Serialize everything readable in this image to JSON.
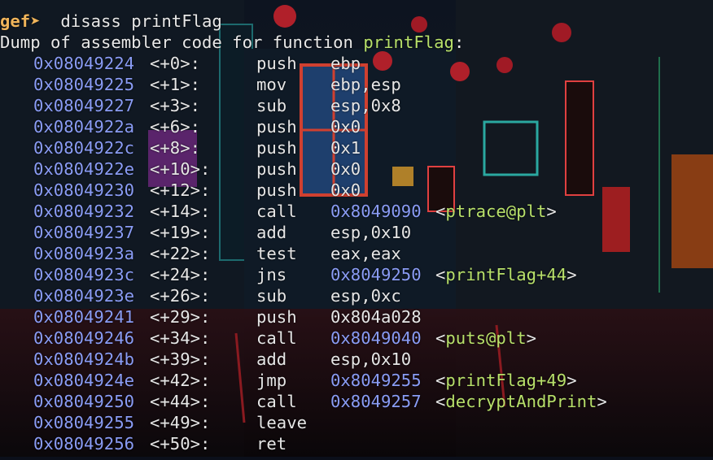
{
  "prompt": {
    "symbol": "gef➤",
    "command": "  disass printFlag"
  },
  "header": {
    "prefix": "Dump of assembler code for function ",
    "function": "printFlag",
    "suffix": ":"
  },
  "instructions": [
    {
      "addr": "0x08049224",
      "off": "<+0>:",
      "mnem": "push",
      "oper": "ebp",
      "target": "",
      "sym": ""
    },
    {
      "addr": "0x08049225",
      "off": "<+1>:",
      "mnem": "mov",
      "oper": "ebp,esp",
      "target": "",
      "sym": ""
    },
    {
      "addr": "0x08049227",
      "off": "<+3>:",
      "mnem": "sub",
      "oper": "esp,0x8",
      "target": "",
      "sym": ""
    },
    {
      "addr": "0x0804922a",
      "off": "<+6>:",
      "mnem": "push",
      "oper": "0x0",
      "target": "",
      "sym": ""
    },
    {
      "addr": "0x0804922c",
      "off": "<+8>:",
      "mnem": "push",
      "oper": "0x1",
      "target": "",
      "sym": ""
    },
    {
      "addr": "0x0804922e",
      "off": "<+10>:",
      "mnem": "push",
      "oper": "0x0",
      "target": "",
      "sym": ""
    },
    {
      "addr": "0x08049230",
      "off": "<+12>:",
      "mnem": "push",
      "oper": "0x0",
      "target": "",
      "sym": ""
    },
    {
      "addr": "0x08049232",
      "off": "<+14>:",
      "mnem": "call",
      "oper": "",
      "target": "0x8049090",
      "sym": "ptrace@plt"
    },
    {
      "addr": "0x08049237",
      "off": "<+19>:",
      "mnem": "add",
      "oper": "esp,0x10",
      "target": "",
      "sym": ""
    },
    {
      "addr": "0x0804923a",
      "off": "<+22>:",
      "mnem": "test",
      "oper": "eax,eax",
      "target": "",
      "sym": ""
    },
    {
      "addr": "0x0804923c",
      "off": "<+24>:",
      "mnem": "jns",
      "oper": "",
      "target": "0x8049250",
      "sym": "printFlag+44"
    },
    {
      "addr": "0x0804923e",
      "off": "<+26>:",
      "mnem": "sub",
      "oper": "esp,0xc",
      "target": "",
      "sym": ""
    },
    {
      "addr": "0x08049241",
      "off": "<+29>:",
      "mnem": "push",
      "oper": "0x804a028",
      "target": "",
      "sym": ""
    },
    {
      "addr": "0x08049246",
      "off": "<+34>:",
      "mnem": "call",
      "oper": "",
      "target": "0x8049040",
      "sym": "puts@plt"
    },
    {
      "addr": "0x0804924b",
      "off": "<+39>:",
      "mnem": "add",
      "oper": "esp,0x10",
      "target": "",
      "sym": ""
    },
    {
      "addr": "0x0804924e",
      "off": "<+42>:",
      "mnem": "jmp",
      "oper": "",
      "target": "0x8049255",
      "sym": "printFlag+49"
    },
    {
      "addr": "0x08049250",
      "off": "<+44>:",
      "mnem": "call",
      "oper": "",
      "target": "0x8049257",
      "sym": "decryptAndPrint"
    },
    {
      "addr": "0x08049255",
      "off": "<+49>:",
      "mnem": "leave",
      "oper": "",
      "target": "",
      "sym": ""
    },
    {
      "addr": "0x08049256",
      "off": "<+50>:",
      "mnem": "ret",
      "oper": "",
      "target": "",
      "sym": ""
    }
  ],
  "colors": {
    "address": "#8a9cf5",
    "symbol": "#b8e06a",
    "prompt": "#f0b45a",
    "text": "#e6e6e6"
  }
}
